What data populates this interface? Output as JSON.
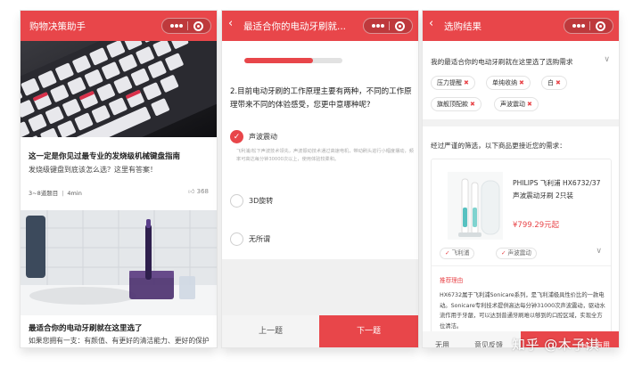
{
  "colors": {
    "accent": "#e8464a",
    "page_bg": "#ffffff",
    "muted": "#999999"
  },
  "panel1": {
    "app_title": "购物决策助手",
    "article1": {
      "title": "这一定是你见过最专业的发烧级机械键盘指南",
      "subtitle": "发烧级键盘到底该怎么选？这里有答案！",
      "meta_questions": "3~8道题目",
      "meta_time": "4min",
      "likes": "368"
    },
    "article2": {
      "title": "最适合你的电动牙刷就在这里选了",
      "desc": "如果您拥有一支：有颜值、有更好的清洁能力、更好的保护牙齿、方便快捷、迅速提高生活品质的牙刷，..."
    }
  },
  "panel2": {
    "title": "最适合你的电动牙刷就...",
    "progress": 0.7,
    "question": "2.目前电动牙刷的工作原理主要有两种，不同的工作原理带来不同的体验感受，您更中意哪种呢?",
    "options": [
      {
        "label": "声波震动",
        "selected": true
      },
      {
        "label": "3D旋转",
        "selected": false
      },
      {
        "label": "无所谓",
        "selected": false
      }
    ],
    "option_desc": "飞利浦/松下声波技术领先，声波振动技术通过高速电机，带动刷头进行小幅度摆动，频率可高达每分钟30000次以上，使用体验较柔和。",
    "prev_label": "上一题",
    "next_label": "下一题"
  },
  "panel3": {
    "title": "选购结果",
    "requirement_title": "我的最适合你的电动牙刷就在这里选了选购需求",
    "tags": [
      "压力提醒",
      "单纯收纳",
      "白",
      "旗舰顶配款",
      "声波震动"
    ],
    "filter_text": "经过严谨的筛选，以下商品更接近您的需求：",
    "product": {
      "name": "PHILIPS 飞利浦 HX6732/37 声波震动牙刷 2只装",
      "price": "¥799.29元起",
      "tags": [
        "飞利浦",
        "声波震动"
      ],
      "reason_title": "推荐理由",
      "reason": "HX6732属于飞利浦Sonicare系列，是飞利浦极具性价比的一款电动。Sonicare专利技术提供高达每分钟31000次声波震动，驱动水流作用于牙龈，可以达到普通牙刷难以够到的口腔区域，实现全方位清洁。"
    },
    "btn_useless": "无用",
    "btn_feedback": "意见反馈",
    "btn_useful": "441 有用"
  },
  "watermark": "知乎 @木子淇",
  "icons": {
    "back": "chevron-left-icon",
    "capsule": "miniprogram-capsule-icon",
    "expand": "chevron-down-icon",
    "remove": "close-icon",
    "check": "check-icon",
    "like": "thumb-up-icon"
  }
}
